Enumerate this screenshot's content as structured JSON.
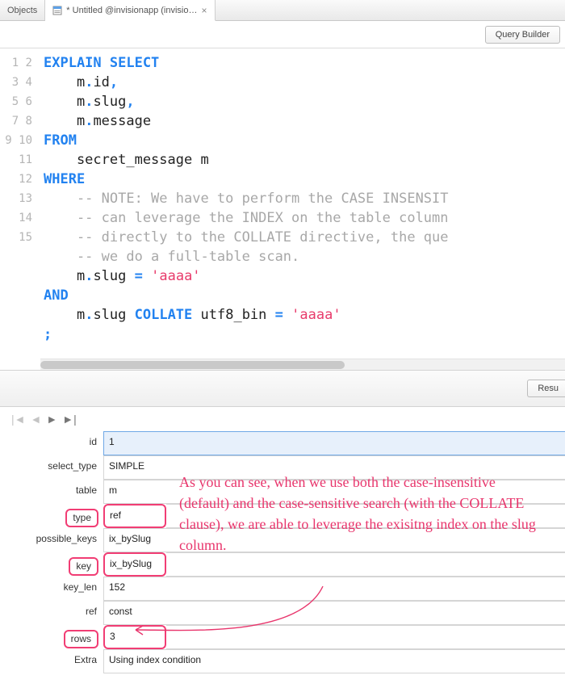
{
  "tabs": [
    {
      "label": "Objects"
    },
    {
      "label": "* Untitled @invisionapp (invisio…"
    }
  ],
  "toolbar": {
    "query_builder": "Query Builder"
  },
  "editor": {
    "line_count": 15,
    "tokens": [
      [
        {
          "t": "EXPLAIN SELECT",
          "c": "kw"
        }
      ],
      [
        {
          "t": "    m",
          "c": ""
        },
        {
          "t": ".",
          "c": "kw"
        },
        {
          "t": "id",
          "c": ""
        },
        {
          "t": ",",
          "c": "kw"
        }
      ],
      [
        {
          "t": "    m",
          "c": ""
        },
        {
          "t": ".",
          "c": "kw"
        },
        {
          "t": "slug",
          "c": ""
        },
        {
          "t": ",",
          "c": "kw"
        }
      ],
      [
        {
          "t": "    m",
          "c": ""
        },
        {
          "t": ".",
          "c": "kw"
        },
        {
          "t": "message",
          "c": ""
        }
      ],
      [
        {
          "t": "FROM",
          "c": "kw"
        }
      ],
      [
        {
          "t": "    secret_message m",
          "c": ""
        }
      ],
      [
        {
          "t": "WHERE",
          "c": "kw"
        }
      ],
      [
        {
          "t": "    -- NOTE: We have to perform the CASE INSENSIT",
          "c": "cm"
        }
      ],
      [
        {
          "t": "    -- can leverage the INDEX on the table column",
          "c": "cm"
        }
      ],
      [
        {
          "t": "    -- directly to the COLLATE directive, the que",
          "c": "cm"
        }
      ],
      [
        {
          "t": "    -- we do a full-table scan.",
          "c": "cm"
        }
      ],
      [
        {
          "t": "    m",
          "c": ""
        },
        {
          "t": ".",
          "c": "kw"
        },
        {
          "t": "slug ",
          "c": ""
        },
        {
          "t": "=",
          "c": "kw"
        },
        {
          "t": " ",
          "c": ""
        },
        {
          "t": "'aaaa'",
          "c": "str"
        }
      ],
      [
        {
          "t": "AND",
          "c": "kw"
        }
      ],
      [
        {
          "t": "    m",
          "c": ""
        },
        {
          "t": ".",
          "c": "kw"
        },
        {
          "t": "slug ",
          "c": ""
        },
        {
          "t": "COLLATE",
          "c": "kw"
        },
        {
          "t": " utf8_bin ",
          "c": ""
        },
        {
          "t": "=",
          "c": "kw"
        },
        {
          "t": " ",
          "c": ""
        },
        {
          "t": "'aaaa'",
          "c": "str"
        }
      ],
      [
        {
          "t": ";",
          "c": "kw"
        }
      ]
    ]
  },
  "splitter": {
    "results_label": "Resu"
  },
  "result": {
    "fields": [
      {
        "label": "id",
        "value": "1",
        "hl_label": false,
        "hl_value": false
      },
      {
        "label": "select_type",
        "value": "SIMPLE",
        "hl_label": false,
        "hl_value": false
      },
      {
        "label": "table",
        "value": "m",
        "hl_label": false,
        "hl_value": false
      },
      {
        "label": "type",
        "value": "ref",
        "hl_label": true,
        "hl_value": true
      },
      {
        "label": "possible_keys",
        "value": "ix_bySlug",
        "hl_label": false,
        "hl_value": false
      },
      {
        "label": "key",
        "value": "ix_bySlug",
        "hl_label": true,
        "hl_value": true
      },
      {
        "label": "key_len",
        "value": "152",
        "hl_label": false,
        "hl_value": false
      },
      {
        "label": "ref",
        "value": "const",
        "hl_label": false,
        "hl_value": false
      },
      {
        "label": "rows",
        "value": "3",
        "hl_label": true,
        "hl_value": true
      },
      {
        "label": "Extra",
        "value": "Using index condition",
        "hl_label": false,
        "hl_value": false
      }
    ]
  },
  "annotation": "As you can see, when we use both the case-insensitive (default) and the case-sensitive search (with the COLLATE clause), we are able to leverage the exisitng index on the slug column."
}
